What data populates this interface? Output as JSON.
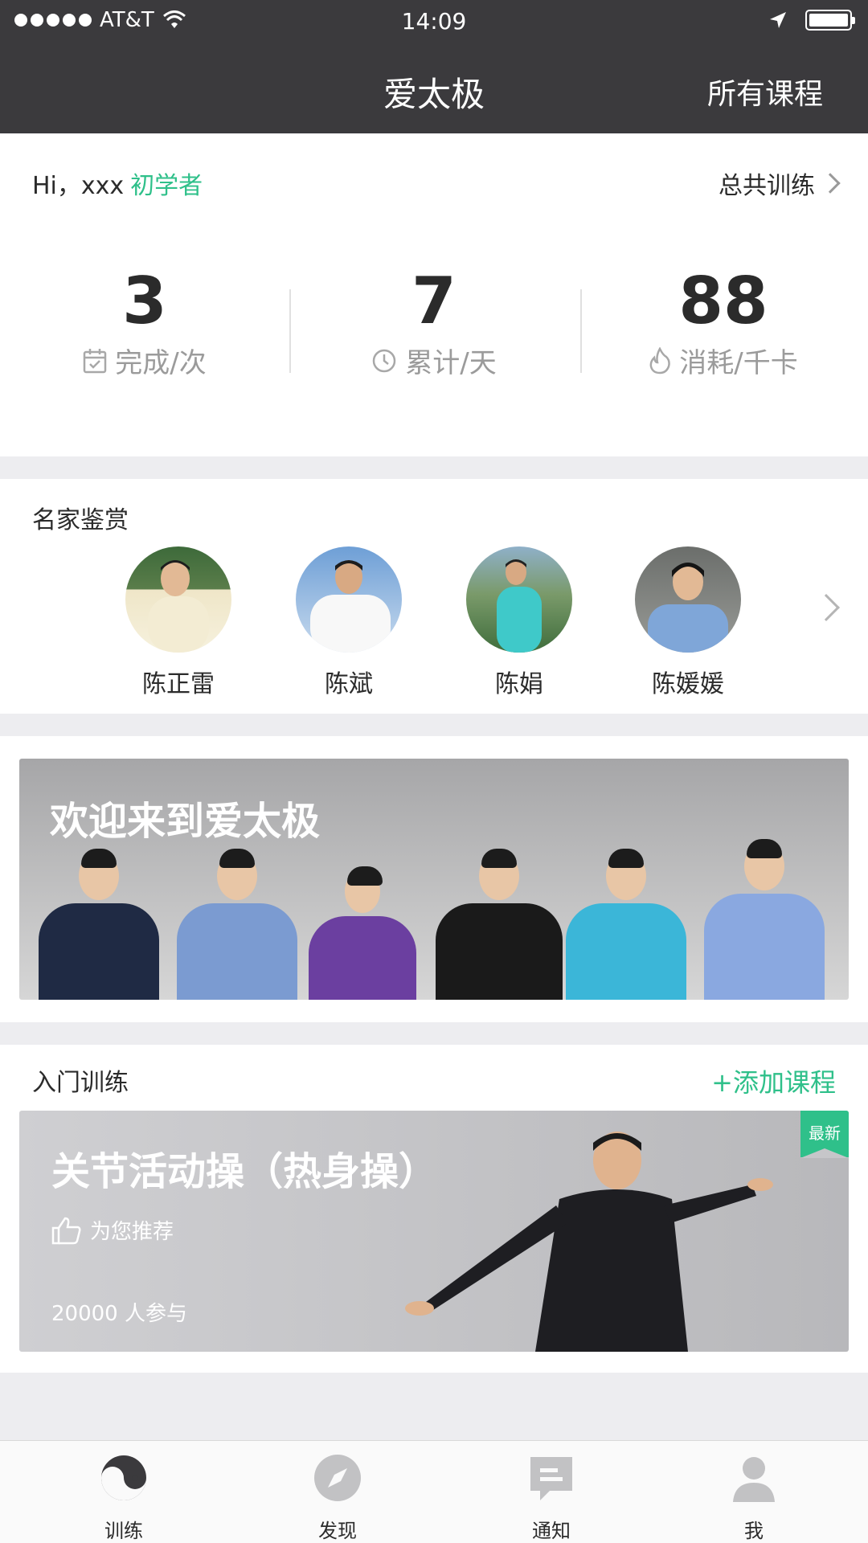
{
  "status": {
    "carrier": "AT&T",
    "time": "14:09"
  },
  "nav": {
    "title": "爱太极",
    "right_link": "所有课程"
  },
  "stats": {
    "greeting": "Hi，xxx",
    "level": "初学者",
    "total_link": "总共训练",
    "items": [
      {
        "value": "3",
        "label": "完成/次",
        "icon": "calendar-check-icon"
      },
      {
        "value": "7",
        "label": "累计/天",
        "icon": "clock-icon"
      },
      {
        "value": "88",
        "label": "消耗/千卡",
        "icon": "flame-icon"
      }
    ]
  },
  "masters": {
    "title": "名家鉴赏",
    "items": [
      {
        "name": "陈正雷"
      },
      {
        "name": "陈斌"
      },
      {
        "name": "陈娟"
      },
      {
        "name": "陈媛媛"
      }
    ]
  },
  "banner": {
    "title": "欢迎来到爱太极"
  },
  "course_section": {
    "title": "入门训练",
    "add_label": "+添加课程",
    "course": {
      "title": "关节活动操（热身操）",
      "badge": "最新",
      "recommend": "为您推荐",
      "participants": "20000 人参与"
    }
  },
  "tabs": [
    {
      "label": "训练",
      "icon": "yin-yang-icon",
      "active": true
    },
    {
      "label": "发现",
      "icon": "compass-icon",
      "active": false
    },
    {
      "label": "通知",
      "icon": "message-icon",
      "active": false
    },
    {
      "label": "我",
      "icon": "user-icon",
      "active": false
    }
  ],
  "colors": {
    "nav_bg": "#3b3a3d",
    "accent": "#2fc08a",
    "background": "#ededf0"
  }
}
